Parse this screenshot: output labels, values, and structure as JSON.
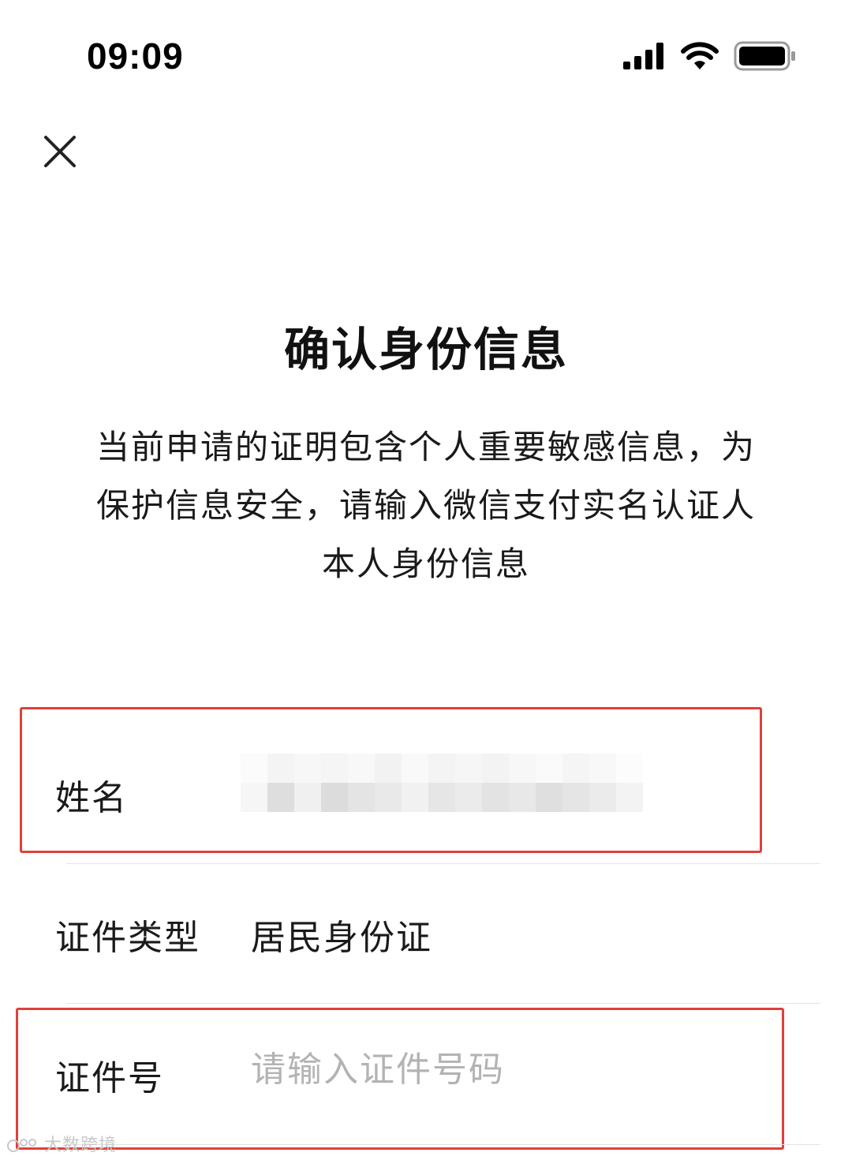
{
  "status_bar": {
    "time": "09:09",
    "signal_icon": "cellular-signal-icon",
    "wifi_icon": "wifi-icon",
    "battery_icon": "battery-icon"
  },
  "nav": {
    "close_icon": "close-icon"
  },
  "header": {
    "title": "确认身份信息",
    "description_lines": [
      "当前申请的证明包含个人重要敏感信息，为",
      "保护信息安全，请输入微信支付实名认证人",
      "本人身份信息"
    ]
  },
  "form": {
    "name_label": "姓名",
    "id_type_label": "证件类型",
    "id_type_value": "居民身份证",
    "id_number_label": "证件号",
    "id_number_placeholder": "请输入证件号码"
  },
  "colors": {
    "highlight_border": "#e0403a",
    "placeholder": "#b3b3b3",
    "divider": "#e3e3e3"
  },
  "watermark": {
    "text": "大数跨境"
  }
}
